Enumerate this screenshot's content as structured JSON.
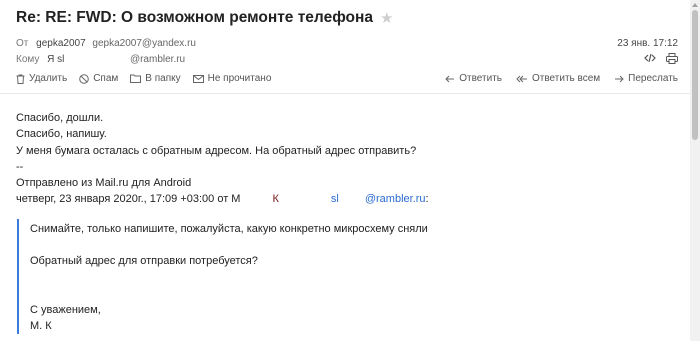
{
  "email": {
    "subject": "Re: RE: FWD: О возможном ремонте телефона",
    "from_label": "От",
    "from_name": "gepka2007",
    "from_email": "gepka2007@yandex.ru",
    "to_label": "Кому",
    "to_name": "Я sl",
    "to_email": "@rambler.ru",
    "date": "23 янв. 17:12"
  },
  "toolbar": {
    "delete": "Удалить",
    "spam": "Спам",
    "to_folder": "В папку",
    "unread": "Не прочитано"
  },
  "actions": {
    "reply": "Ответить",
    "reply_all": "Ответить всем",
    "forward": "Переслать"
  },
  "body": {
    "lines": [
      "Спасибо, дошли.",
      "Спасибо, напишу.",
      "У меня бумага осталась с обратным адресом. На обратный адрес отправить?",
      "--",
      "Отправлено из Mail.ru для Android"
    ],
    "reply_header_prefix": "четверг, 23 января 2020г., 17:09 +03:00 от М",
    "reply_header_k": "К",
    "reply_header_sl": "sl",
    "reply_header_email": "@rambler.ru",
    "reply_header_suffix": ":"
  },
  "quote": {
    "line1": "Снимайте, только напишите, пожалуйста, какую конкретно микросхему сняли",
    "line2": "Обратный адрес для отправки потребуется?",
    "sign1": "С уважением,",
    "sign2": "М. К"
  }
}
